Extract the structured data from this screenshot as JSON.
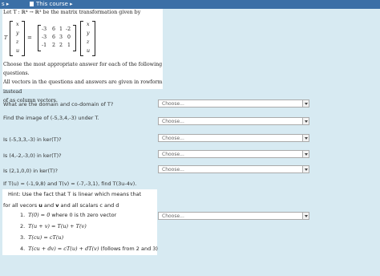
{
  "topbar": {
    "left_label": "s ▸",
    "course_label": "This course ▸"
  },
  "problem": {
    "statement": "Let  T : ℝ⁴ → ℝ³  be the matrix transformation given by",
    "t_label": "T",
    "equals": "=",
    "vector_left": [
      "x",
      "y",
      "z",
      "u"
    ],
    "matrix": [
      [
        "-3",
        "6",
        "1",
        "-2"
      ],
      [
        "-3",
        "6",
        "3",
        "0"
      ],
      [
        "-1",
        "2",
        "2",
        "1"
      ]
    ],
    "vector_right": [
      "x",
      "y",
      "z",
      "u"
    ],
    "instructions": [
      "Choose the most appropriate answer for each of the following questions.",
      "All vectors in the questions and answers are given in rowform instead",
      "of as column vectors."
    ]
  },
  "questions": [
    {
      "text": "What are the domain and co-domain of T?",
      "selected": "Choose..."
    },
    {
      "text": "Find the image of (-5,3,4,-3) under T.",
      "selected": "Choose..."
    },
    {
      "text": "Is (-5,3,3,-3) in ker(T)?",
      "selected": "Choose..."
    },
    {
      "text": "Is (4,-2,-3,0) in ker(T)?",
      "selected": "Choose..."
    },
    {
      "text": "Is (2,1,0,0) in ker(T)?",
      "selected": "Choose..."
    },
    {
      "text": "If T(u) = (-1,9,8) and T(v) = (-7,-3,1), find T(3u-4v).",
      "selected": "Choose..."
    }
  ],
  "hint": {
    "line1": "Hint: Use the fact that T is linear which means that",
    "line2_a": "for all vecors ",
    "line2_u": "u",
    "line2_b": " and ",
    "line2_v": "v",
    "line2_c": " and all scalars c and d",
    "items": [
      {
        "num": "1.",
        "math": "T(0) = 0",
        "note": "  where 0 is th zero vector"
      },
      {
        "num": "2.",
        "math": "T(u + v) = T(u) + T(v)",
        "note": ""
      },
      {
        "num": "3.",
        "math": "T(cu) = cT(u)",
        "note": ""
      },
      {
        "num": "4.",
        "math": "T(cu + dv) = cT(u) + dT(v)",
        "note": "   (follows from 2 and 3)"
      }
    ]
  },
  "icons": {
    "select_arrow": "chevron-down-icon",
    "breadcrumb_doc": "document-icon"
  }
}
